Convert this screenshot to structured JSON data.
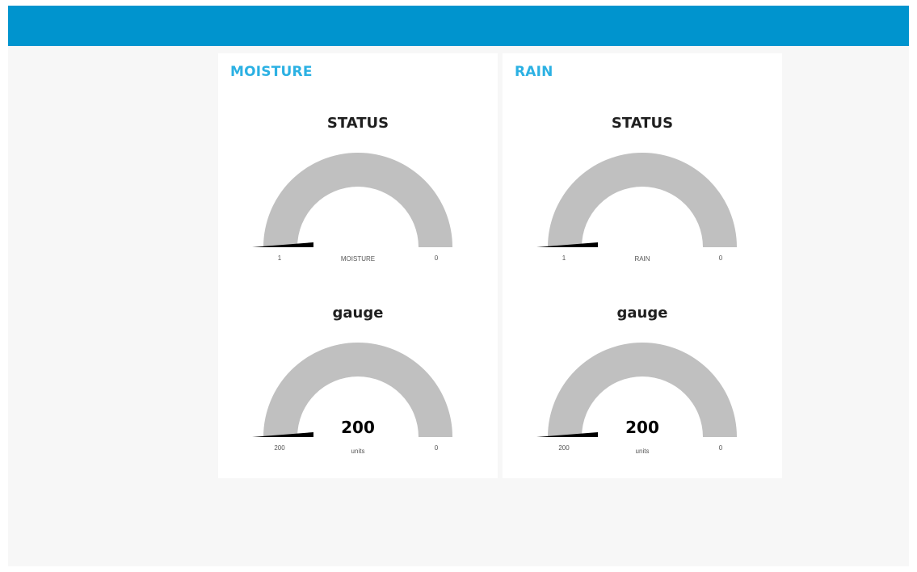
{
  "colors": {
    "header": "#0094ce",
    "group_title": "#2cb1e3",
    "gauge_track": "#c0c0c0",
    "needle": "#000000",
    "background": "#f7f7f7"
  },
  "groups": [
    {
      "title": "MOISTURE",
      "widgets": [
        {
          "title": "STATUS",
          "value": 1,
          "display": "",
          "label": "MOISTURE",
          "min_label": "1",
          "max_label": "0",
          "min": 1,
          "max": 0
        },
        {
          "title": "gauge",
          "value": 200,
          "display": "200",
          "label": "units",
          "min_label": "200",
          "max_label": "0",
          "min": 200,
          "max": 0
        }
      ]
    },
    {
      "title": "RAIN",
      "widgets": [
        {
          "title": "STATUS",
          "value": 1,
          "display": "",
          "label": "RAIN",
          "min_label": "1",
          "max_label": "0",
          "min": 1,
          "max": 0
        },
        {
          "title": "gauge",
          "value": 200,
          "display": "200",
          "label": "units",
          "min_label": "200",
          "max_label": "0",
          "min": 200,
          "max": 0
        }
      ]
    }
  ]
}
